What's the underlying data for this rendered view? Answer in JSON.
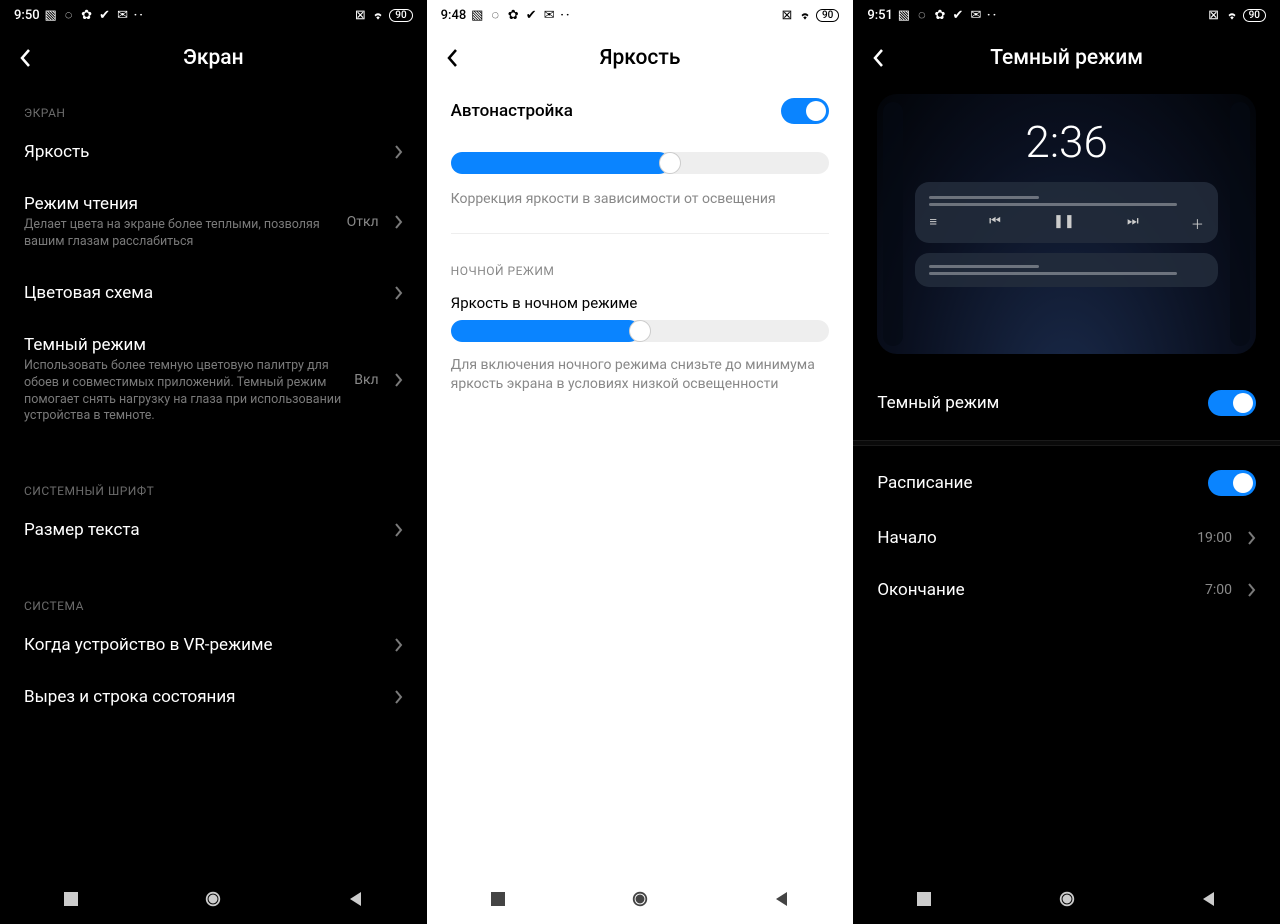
{
  "status": {
    "battery": "90",
    "dots": "··"
  },
  "panel1": {
    "time": "9:50",
    "title": "Экран",
    "section_display": "Экран",
    "brightness": "Яркость",
    "reading_title": "Режим чтения",
    "reading_sub": "Делает цвета на экране более теплыми, позволяя вашим глазам расслабиться",
    "reading_value": "Откл",
    "color_scheme": "Цветовая схема",
    "dark_title": "Темный режим",
    "dark_sub": "Использовать более темную цветовую палитру для обоев и совместимых приложений. Темный режим помогает снять нагрузку на глаза при использовании устройства в темноте.",
    "dark_value": "Вкл",
    "section_font": "Системный шрифт",
    "text_size": "Размер текста",
    "section_system": "Система",
    "vr_mode": "Когда устройство в VR-режиме",
    "cutout": "Вырез и строка состояния"
  },
  "panel2": {
    "time": "9:48",
    "title": "Яркость",
    "auto_label": "Автонастройка",
    "auto_note": "Коррекция яркости в зависимости от освещения",
    "section_night": "Ночной режим",
    "night_label": "Яркость в ночном режиме",
    "night_note": "Для включения ночного режима снизьте до минимума яркость экрана в условиях низкой освещенности"
  },
  "panel3": {
    "time": "9:51",
    "title": "Темный режим",
    "preview_time": "2:36",
    "dark_toggle": "Темный режим",
    "schedule": "Расписание",
    "start_label": "Начало",
    "start_value": "19:00",
    "end_label": "Окончание",
    "end_value": "7:00"
  }
}
